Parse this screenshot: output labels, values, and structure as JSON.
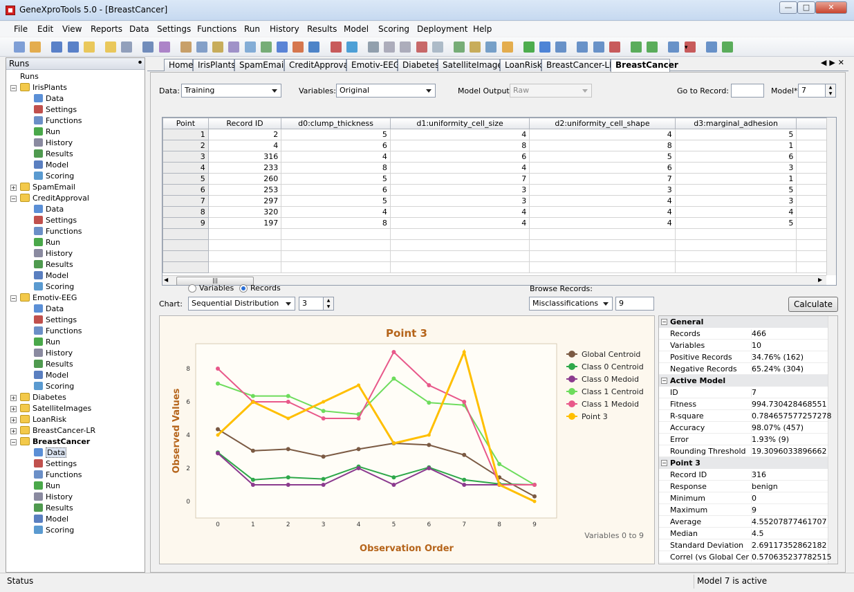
{
  "window": {
    "title": "GeneXproTools 5.0 - [BreastCancer]"
  },
  "menu": [
    "File",
    "Edit",
    "View",
    "Reports",
    "Data",
    "Settings",
    "Functions",
    "Run",
    "History",
    "Results",
    "Model",
    "Scoring",
    "Deployment",
    "Help"
  ],
  "sidebar": {
    "title": "Runs",
    "root": "Runs",
    "projects": [
      {
        "name": "IrisPlants",
        "expanded": true
      },
      {
        "name": "SpamEmail",
        "expanded": false
      },
      {
        "name": "CreditApproval",
        "expanded": true
      },
      {
        "name": "Emotiv-EEG",
        "expanded": true
      },
      {
        "name": "Diabetes",
        "expanded": false
      },
      {
        "name": "SatelliteImages",
        "expanded": false
      },
      {
        "name": "LoanRisk",
        "expanded": false
      },
      {
        "name": "BreastCancer-LR",
        "expanded": false
      },
      {
        "name": "BreastCancer",
        "expanded": true,
        "selected": "Data"
      }
    ],
    "children": [
      "Data",
      "Settings",
      "Functions",
      "Run",
      "History",
      "Results",
      "Model",
      "Scoring"
    ]
  },
  "tabs": [
    "Home",
    "IrisPlants",
    "SpamEmail",
    "CreditApproval",
    "Emotiv-EEG",
    "Diabetes",
    "SatelliteImages",
    "LoanRisk",
    "BreastCancer-LR",
    "BreastCancer"
  ],
  "active_tab": "BreastCancer",
  "controls": {
    "data_label": "Data:",
    "data_value": "Training",
    "variables_label": "Variables:",
    "variables_value": "Original",
    "model_output_label": "Model Output:",
    "model_output_value": "Raw",
    "goto_label": "Go to Record:",
    "goto_value": "",
    "model_label": "Model*:",
    "model_value": "7"
  },
  "grid": {
    "columns": [
      "Point",
      "Record ID",
      "d0:clump_thickness",
      "d1:uniformity_cell_size",
      "d2:uniformity_cell_shape",
      "d3:marginal_adhesion"
    ],
    "rows": [
      [
        "1",
        "2",
        "5",
        "4",
        "4",
        "5"
      ],
      [
        "2",
        "4",
        "6",
        "8",
        "8",
        "1"
      ],
      [
        "3",
        "316",
        "4",
        "6",
        "5",
        "6"
      ],
      [
        "4",
        "233",
        "8",
        "4",
        "6",
        "3"
      ],
      [
        "5",
        "260",
        "5",
        "7",
        "7",
        "1"
      ],
      [
        "6",
        "253",
        "6",
        "3",
        "3",
        "5"
      ],
      [
        "7",
        "297",
        "5",
        "3",
        "4",
        "3"
      ],
      [
        "8",
        "320",
        "4",
        "4",
        "4",
        "4"
      ],
      [
        "9",
        "197",
        "8",
        "4",
        "4",
        "5"
      ]
    ]
  },
  "lower": {
    "radio_variables": "Variables",
    "radio_records": "Records",
    "radio_selected": "Records",
    "chart_label": "Chart:",
    "chart_type": "Sequential Distribution",
    "chart_param": "3",
    "browse_label": "Browse Records:",
    "browse_value": "Misclassifications",
    "browse_count": "9",
    "calculate": "Calculate"
  },
  "chart_data": {
    "type": "line",
    "title": "Point 3",
    "xlabel": "Observation Order",
    "ylabel": "Observed Values",
    "note": "Variables 0 to 9",
    "x": [
      0,
      1,
      2,
      3,
      4,
      5,
      6,
      7,
      8,
      9
    ],
    "ylim": [
      -1,
      9.5
    ],
    "yticks": [
      0,
      2,
      4,
      6,
      8
    ],
    "series": [
      {
        "name": "Global Centroid",
        "color": "#7b5a43",
        "values": [
          4.35,
          3.05,
          3.15,
          2.7,
          3.15,
          3.5,
          3.4,
          2.8,
          1.45,
          0.3
        ]
      },
      {
        "name": "Class 0 Centroid",
        "color": "#2ea84a",
        "values": [
          2.95,
          1.3,
          1.45,
          1.35,
          2.1,
          1.45,
          2.05,
          1.3,
          1.05,
          1.0
        ]
      },
      {
        "name": "Class 0 Medoid",
        "color": "#8b3a8e",
        "values": [
          2.9,
          1.0,
          1.0,
          1.0,
          2.0,
          1.0,
          2.0,
          1.0,
          1.0,
          1.0
        ]
      },
      {
        "name": "Class 1 Centroid",
        "color": "#6ddc5c",
        "values": [
          7.1,
          6.35,
          6.35,
          5.45,
          5.25,
          7.4,
          5.95,
          5.8,
          2.25,
          1.0
        ]
      },
      {
        "name": "Class 1 Medoid",
        "color": "#e8588a",
        "values": [
          8.0,
          6.0,
          6.0,
          5.0,
          5.0,
          9.0,
          7.0,
          6.0,
          1.0,
          1.0
        ]
      },
      {
        "name": "Point 3",
        "color": "#ffbf00",
        "values": [
          4.0,
          6.0,
          5.0,
          6.0,
          7.0,
          3.5,
          4.0,
          9.0,
          1.0,
          0.0
        ]
      }
    ]
  },
  "properties": [
    {
      "section": "General",
      "rows": [
        [
          "Records",
          "466"
        ],
        [
          "Variables",
          "10"
        ],
        [
          "Positive Records",
          "34.76% (162)"
        ],
        [
          "Negative Records",
          "65.24% (304)"
        ]
      ]
    },
    {
      "section": "Active Model",
      "rows": [
        [
          "ID",
          "7"
        ],
        [
          "Fitness",
          "994.730428468551"
        ],
        [
          "R-square",
          "0.784657577257278"
        ],
        [
          "Accuracy",
          "98.07% (457)"
        ],
        [
          "Error",
          "1.93% (9)"
        ],
        [
          "Rounding Threshold",
          "19.3096033896662"
        ]
      ]
    },
    {
      "section": "Point 3",
      "rows": [
        [
          "Record ID",
          "316"
        ],
        [
          "Response",
          "benign"
        ],
        [
          "Minimum",
          "0"
        ],
        [
          "Maximum",
          "9"
        ],
        [
          "Average",
          "4.55207877461707"
        ],
        [
          "Median",
          "4.5"
        ],
        [
          "Standard Deviation",
          "2.69117352862182"
        ],
        [
          "Correl (vs Global Centroid)",
          "0.570635237782515"
        ]
      ]
    }
  ],
  "status": {
    "left": "Status",
    "right": "Model 7 is active"
  },
  "colors": {
    "accent": "#b5641a",
    "chart_bg": "#fdf8ee",
    "plot_bg": "#fffdf7"
  }
}
